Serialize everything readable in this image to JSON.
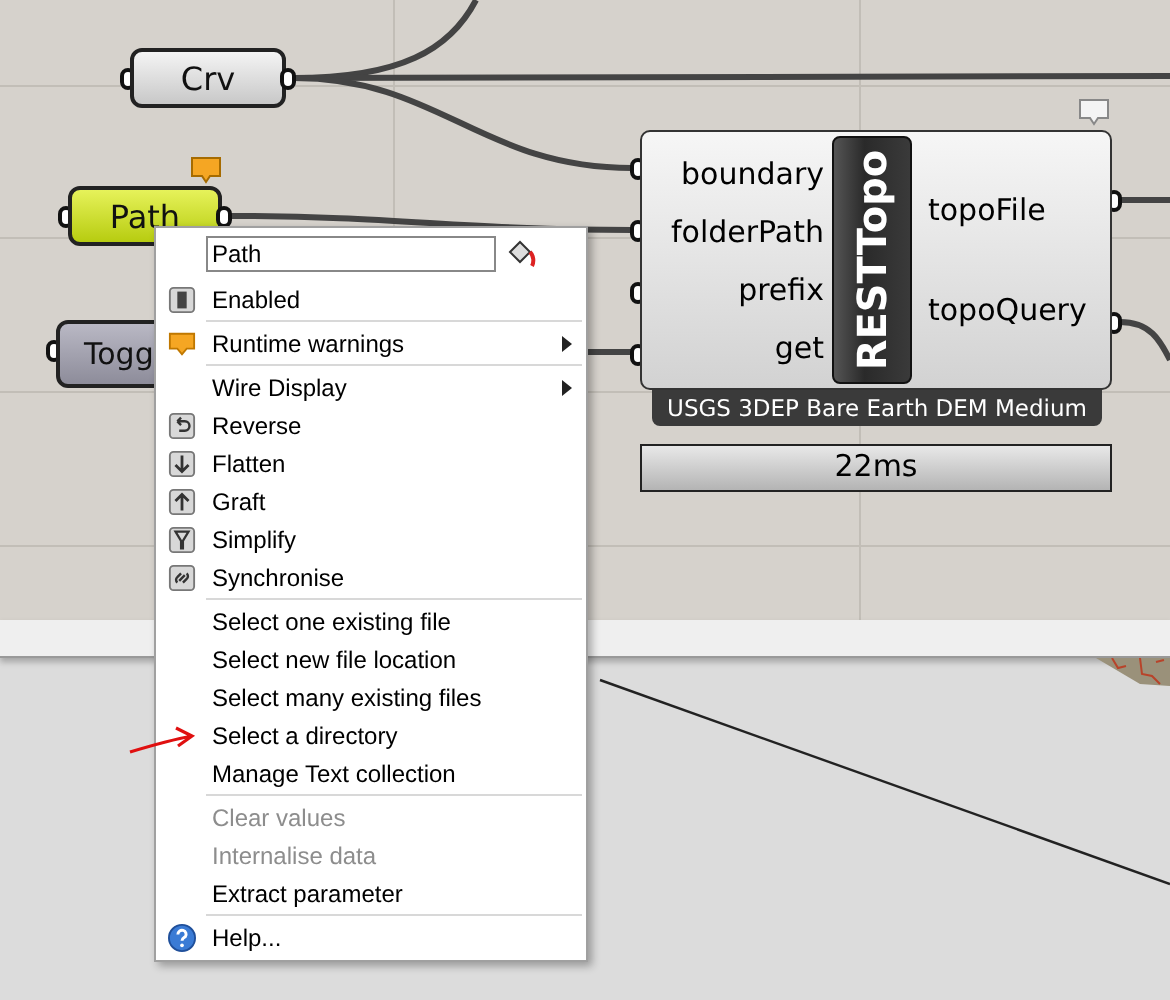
{
  "canvas": {
    "params": [
      {
        "kind": "param",
        "label": "Crv",
        "selected": false,
        "warning": false
      },
      {
        "kind": "param",
        "label": "Path",
        "selected": true,
        "warning": true
      },
      {
        "kind": "toggle",
        "label": "Togg",
        "selected": false,
        "warning": false
      }
    ],
    "component": {
      "name": "RESTTopo",
      "remark": true,
      "inputs": [
        "boundary",
        "folderPath",
        "prefix",
        "get"
      ],
      "outputs": [
        "topoFile",
        "topoQuery"
      ],
      "message": "USGS 3DEP Bare Earth DEM Medium",
      "profiler": "22ms"
    }
  },
  "context_menu": {
    "name_field": {
      "value": "Path"
    },
    "items": [
      {
        "kind": "item",
        "label": "Enabled",
        "submenu": false,
        "disabled": false
      },
      {
        "kind": "separator"
      },
      {
        "kind": "item",
        "label": "Runtime warnings",
        "submenu": true,
        "disabled": false
      },
      {
        "kind": "separator"
      },
      {
        "kind": "item",
        "label": "Wire Display",
        "submenu": true,
        "disabled": false
      },
      {
        "kind": "item",
        "label": "Reverse",
        "submenu": false,
        "disabled": false
      },
      {
        "kind": "item",
        "label": "Flatten",
        "submenu": false,
        "disabled": false
      },
      {
        "kind": "item",
        "label": "Graft",
        "submenu": false,
        "disabled": false
      },
      {
        "kind": "item",
        "label": "Simplify",
        "submenu": false,
        "disabled": false
      },
      {
        "kind": "item",
        "label": "Synchronise",
        "submenu": false,
        "disabled": false
      },
      {
        "kind": "separator"
      },
      {
        "kind": "item",
        "label": "Select one existing file",
        "submenu": false,
        "disabled": false
      },
      {
        "kind": "item",
        "label": "Select new file location",
        "submenu": false,
        "disabled": false
      },
      {
        "kind": "item",
        "label": "Select many existing files",
        "submenu": false,
        "disabled": false
      },
      {
        "kind": "item",
        "label": "Select a directory",
        "submenu": false,
        "disabled": false
      },
      {
        "kind": "item",
        "label": "Manage Text collection",
        "submenu": false,
        "disabled": false
      },
      {
        "kind": "separator"
      },
      {
        "kind": "item",
        "label": "Clear values",
        "submenu": false,
        "disabled": true
      },
      {
        "kind": "item",
        "label": "Internalise data",
        "submenu": false,
        "disabled": true
      },
      {
        "kind": "item",
        "label": "Extract parameter",
        "submenu": false,
        "disabled": false
      },
      {
        "kind": "separator"
      },
      {
        "kind": "item",
        "label": "Help...",
        "submenu": false,
        "disabled": false
      }
    ]
  }
}
